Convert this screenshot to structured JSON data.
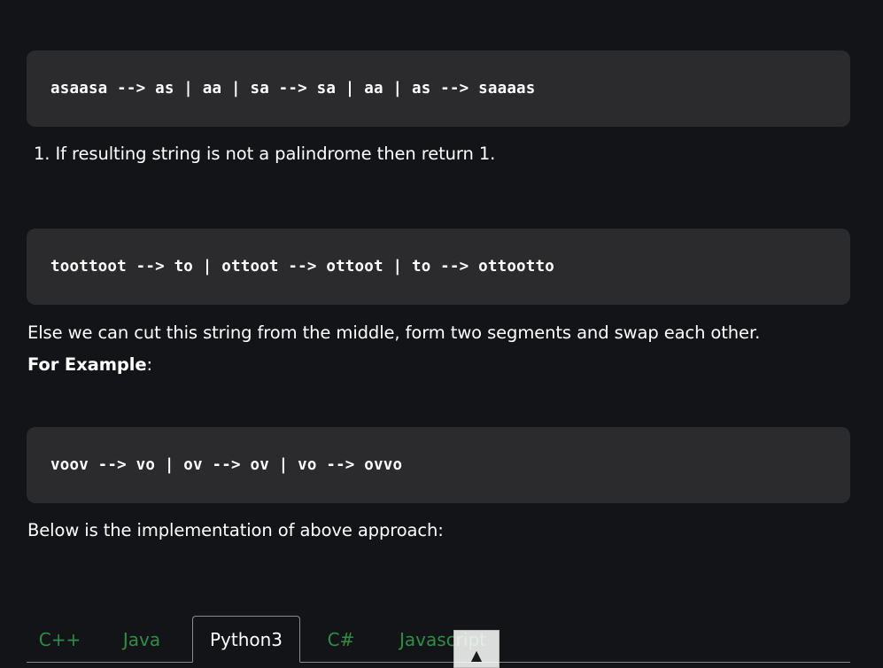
{
  "code_blocks": {
    "block1": "asaasa --> as | aa | sa --> sa | aa | as --> saaaas",
    "block2": "toottoot --> to | ottoot --> ottoot | to --> ottootto",
    "block3": "voov --> vo | ov --> ov | vo --> ovvo"
  },
  "paragraphs": {
    "list_item_1": "1. If resulting string is not a palindrome then return 1.",
    "else_text": "Else we can cut this string from the middle, form two segments and swap each other.",
    "for_example_bold": "For Example",
    "for_example_colon": ":",
    "below_text": "Below is the implementation of above approach:"
  },
  "tabs": [
    {
      "label": "C++",
      "active": false
    },
    {
      "label": "Java",
      "active": false
    },
    {
      "label": "Python3",
      "active": true
    },
    {
      "label": "C#",
      "active": false
    },
    {
      "label": "Javascript",
      "active": false
    }
  ],
  "scroll_top": {
    "icon": "arrow-up-icon",
    "glyph": "▲"
  },
  "colors": {
    "background": "#131417",
    "code_background": "#2b2b2e",
    "tab_inactive": "#2f8d46",
    "text": "#ffffff"
  }
}
